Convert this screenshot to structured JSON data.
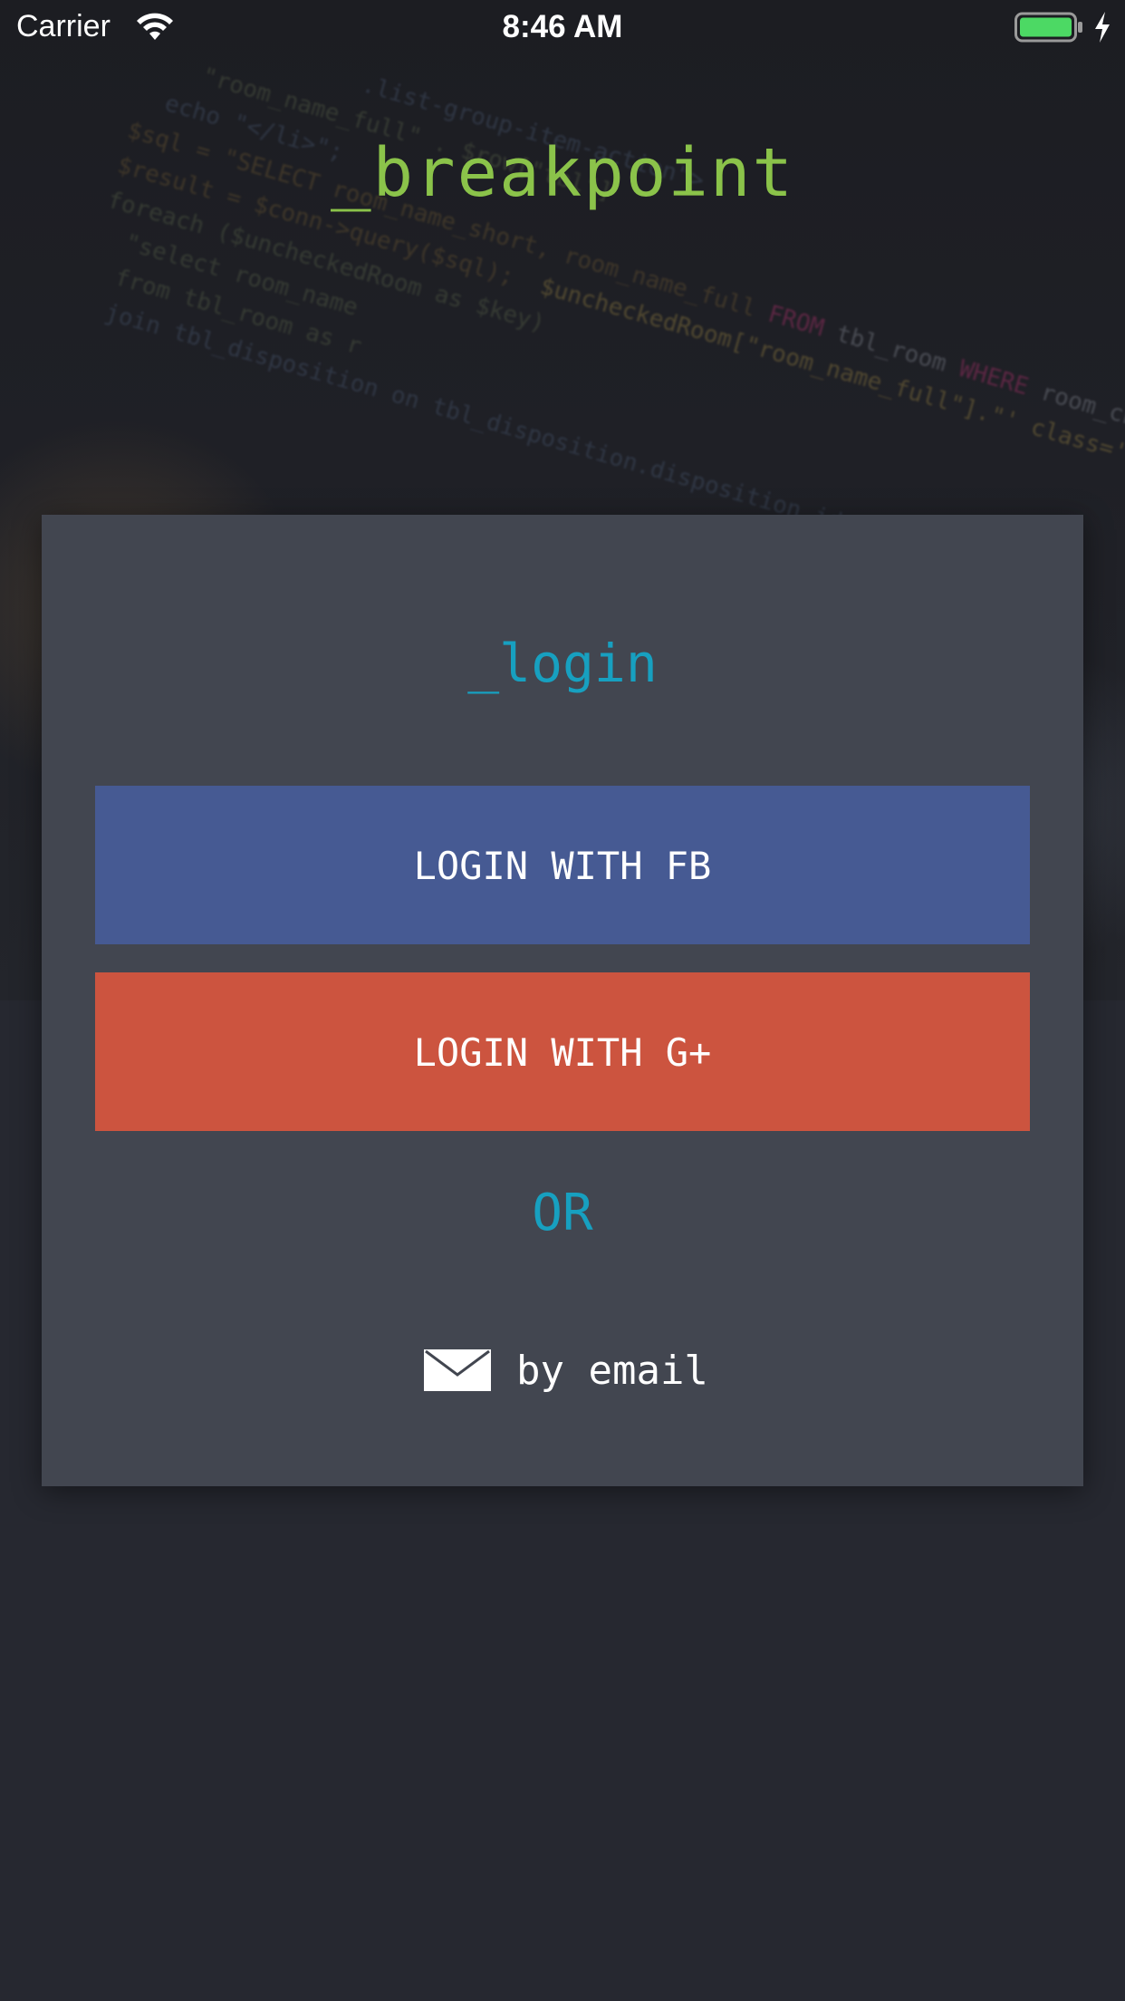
{
  "status_bar": {
    "carrier": "Carrier",
    "time": "8:46 AM",
    "icons": [
      "wifi-icon",
      "battery-icon",
      "charging-bolt-icon"
    ]
  },
  "app": {
    "title": "_breakpoint"
  },
  "login_card": {
    "title": "_login",
    "fb_button": "LOGIN WITH FB",
    "gplus_button": "LOGIN WITH G+",
    "or_label": "OR",
    "email_label": "by email",
    "email_icon": "mail-icon"
  },
  "colors": {
    "brand_green": "#8bc34a",
    "accent_cyan": "#17a0c0",
    "facebook_blue": "#465a93",
    "google_red": "#cc543f",
    "card_bg": "#424650",
    "page_bg": "#262830"
  }
}
